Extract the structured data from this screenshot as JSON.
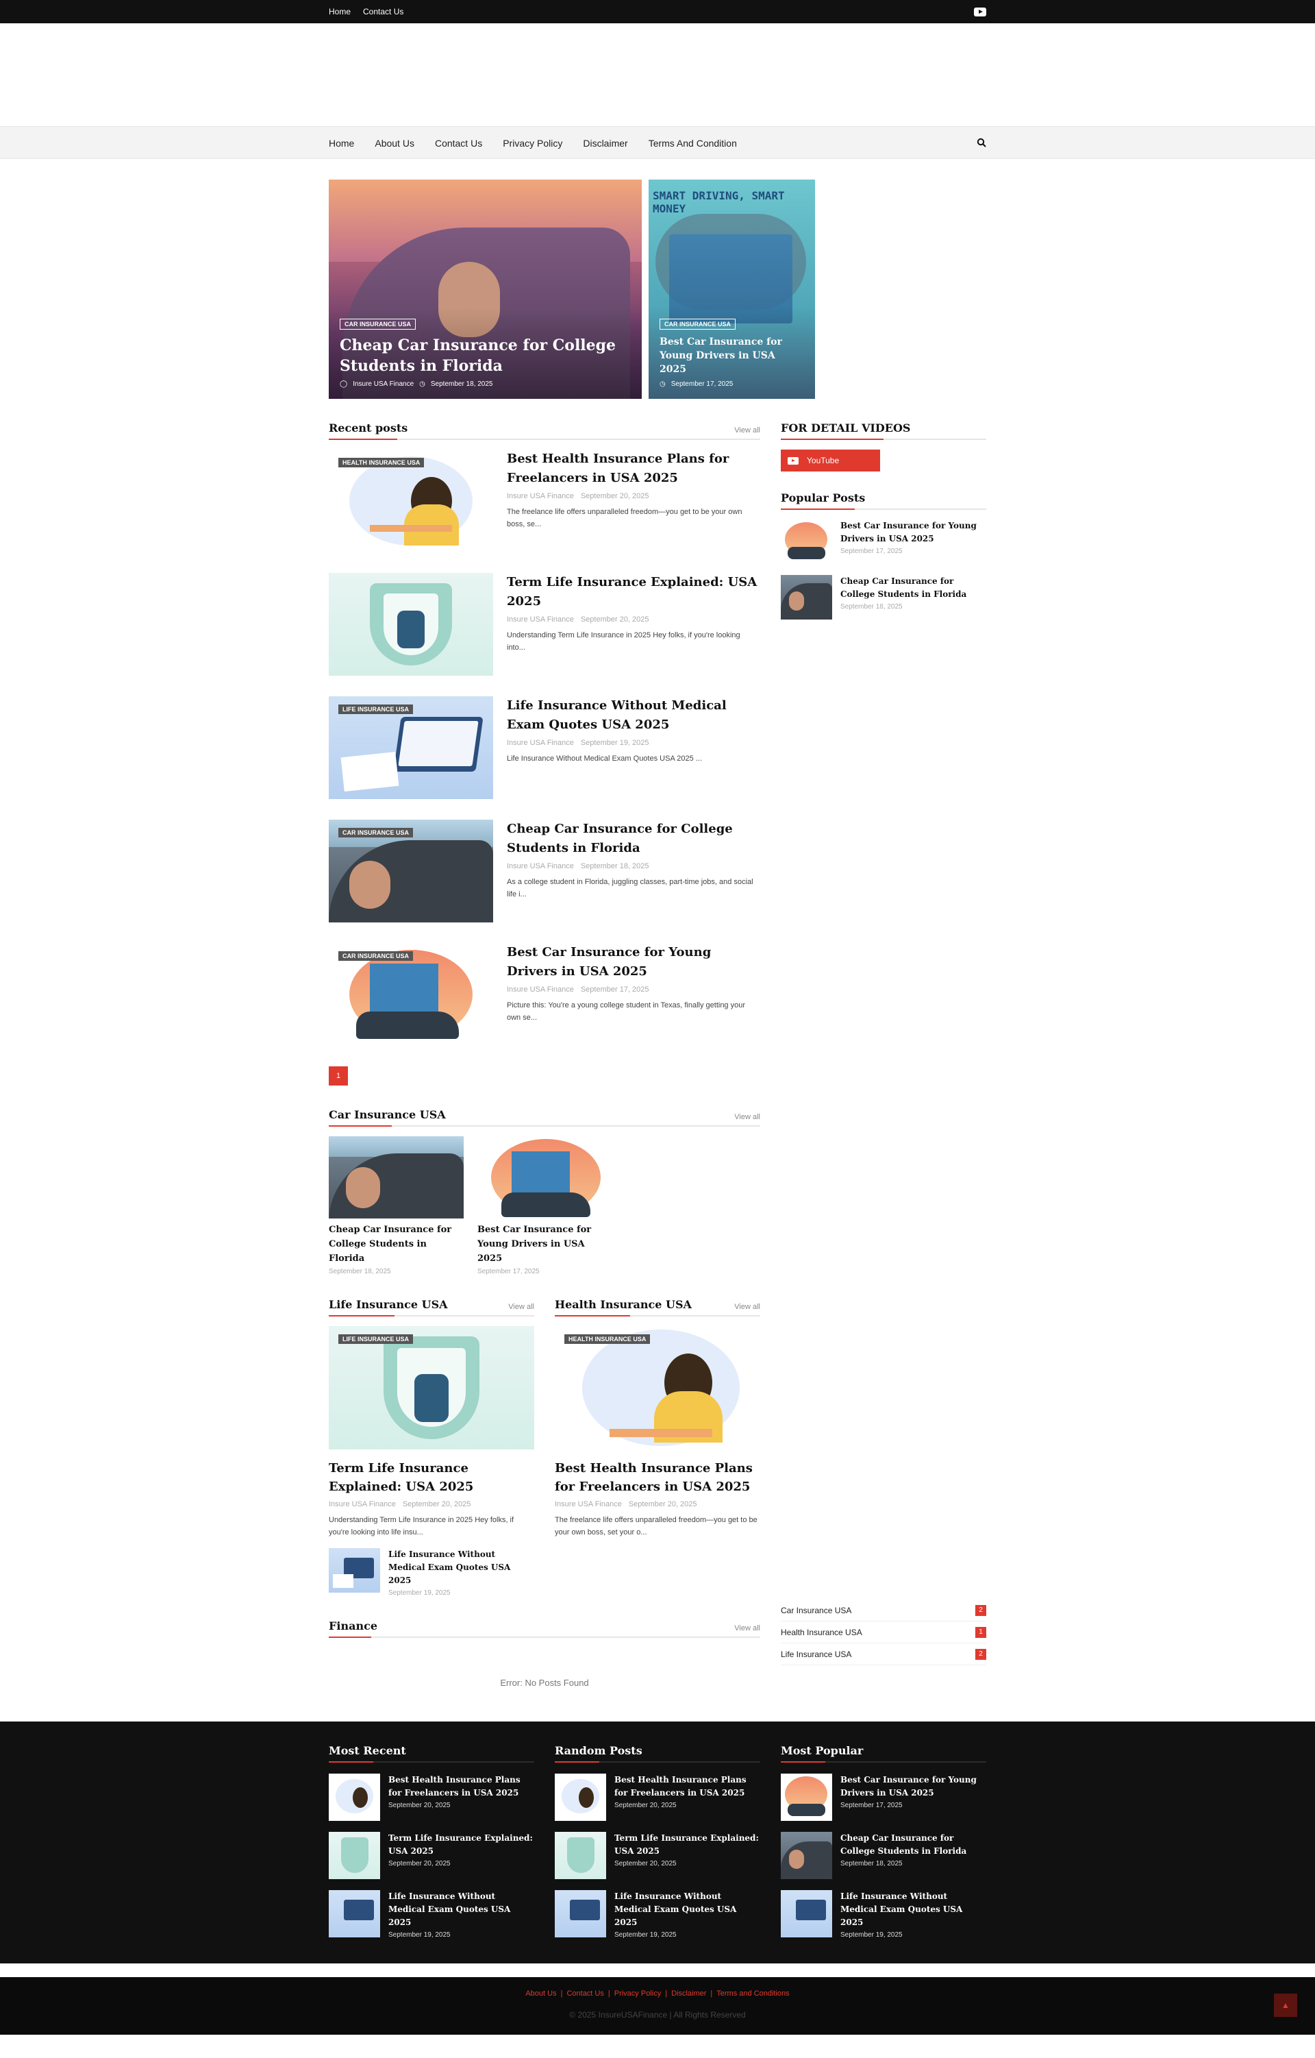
{
  "topbar": {
    "links": [
      "Home",
      "Contact Us"
    ]
  },
  "nav": {
    "items": [
      "Home",
      "About Us",
      "Contact Us",
      "Privacy Policy",
      "Disclaimer",
      "Terms And Condition"
    ]
  },
  "featured": {
    "big": {
      "badge": "CAR INSURANCE USA",
      "title": "Cheap Car Insurance for College Students in Florida",
      "author": "Insure USA Finance",
      "date": "September 18, 2025"
    },
    "small": {
      "banner": "SMART DRIVING, SMART MONEY",
      "badge": "CAR INSURANCE USA",
      "title": "Best Car Insurance for Young Drivers in USA 2025",
      "date": "September 17, 2025"
    }
  },
  "recent": {
    "heading": "Recent posts",
    "view_all": "View all",
    "posts": [
      {
        "label": "HEALTH INSURANCE USA",
        "title": "Best Health Insurance Plans for Freelancers in USA 2025",
        "author": "Insure USA Finance",
        "date": "September 20, 2025",
        "excerpt": "The freelance life offers unparalleled freedom—you get to be your own boss, se..."
      },
      {
        "label": "",
        "title": "Term Life Insurance Explained: USA 2025",
        "author": "Insure USA Finance",
        "date": "September 20, 2025",
        "excerpt": "Understanding Term Life Insurance in 2025 Hey folks, if you're looking into..."
      },
      {
        "label": "LIFE INSURANCE USA",
        "title": "Life Insurance Without Medical Exam Quotes USA 2025",
        "author": "Insure USA Finance",
        "date": "September 19, 2025",
        "excerpt": "Life Insurance Without Medical Exam Quotes USA 2025 ..."
      },
      {
        "label": "CAR INSURANCE USA",
        "title": "Cheap Car Insurance for College Students in Florida",
        "author": "Insure USA Finance",
        "date": "September 18, 2025",
        "excerpt": "As a college student in Florida, juggling classes, part-time jobs, and social life i..."
      },
      {
        "label": "CAR INSURANCE USA",
        "title": "Best Car Insurance for Young Drivers in USA 2025",
        "author": "Insure USA Finance",
        "date": "September 17, 2025",
        "excerpt": "Picture this: You're a young college student in Texas, finally getting your own se..."
      }
    ],
    "page": "1"
  },
  "car_section": {
    "heading": "Car Insurance USA",
    "view_all": "View all",
    "cards": [
      {
        "title": "Cheap Car Insurance for College Students in Florida",
        "date": "September 18, 2025"
      },
      {
        "title": "Best Car Insurance for Young Drivers in USA 2025",
        "date": "September 17, 2025"
      }
    ]
  },
  "life_section": {
    "heading": "Life Insurance USA",
    "view_all": "View all",
    "label": "LIFE INSURANCE USA",
    "title": "Term Life Insurance Explained: USA 2025",
    "author": "Insure USA Finance",
    "date": "September 20, 2025",
    "excerpt": "Understanding Term Life Insurance in 2025 Hey folks, if you're looking into life insu...",
    "small": {
      "title": "Life Insurance Without Medical Exam Quotes USA 2025",
      "date": "September 19, 2025"
    }
  },
  "health_section": {
    "heading": "Health Insurance USA",
    "view_all": "View all",
    "label": "HEALTH INSURANCE USA",
    "title": "Best Health Insurance Plans for Freelancers in USA 2025",
    "author": "Insure USA Finance",
    "date": "September 20, 2025",
    "excerpt": "The freelance life offers unparalleled freedom—you get to be your own boss, set your o..."
  },
  "finance_section": {
    "heading": "Finance",
    "view_all": "View all",
    "error": "Error: No Posts Found"
  },
  "sidebar": {
    "videos_heading": "FOR DETAIL VIDEOS",
    "youtube_label": "YouTube",
    "popular_heading": "Popular Posts",
    "popular": [
      {
        "title": "Best Car Insurance for Young Drivers in USA 2025",
        "date": "September 17, 2025"
      },
      {
        "title": "Cheap Car Insurance for College Students in Florida",
        "date": "September 18, 2025"
      }
    ],
    "labels": [
      {
        "name": "Car Insurance USA",
        "count": "2"
      },
      {
        "name": "Health Insurance USA",
        "count": "1"
      },
      {
        "name": "Life Insurance USA",
        "count": "2"
      }
    ]
  },
  "footer": {
    "most_recent": {
      "heading": "Most Recent",
      "items": [
        {
          "title": "Best Health Insurance Plans for Freelancers in USA 2025",
          "date": "September 20, 2025"
        },
        {
          "title": "Term Life Insurance Explained: USA 2025",
          "date": "September 20, 2025"
        },
        {
          "title": "Life Insurance Without Medical Exam Quotes USA 2025",
          "date": "September 19, 2025"
        }
      ]
    },
    "random": {
      "heading": "Random Posts",
      "items": [
        {
          "title": "Best Health Insurance Plans for Freelancers in USA 2025",
          "date": "September 20, 2025"
        },
        {
          "title": "Term Life Insurance Explained: USA 2025",
          "date": "September 20, 2025"
        },
        {
          "title": "Life Insurance Without Medical Exam Quotes USA 2025",
          "date": "September 19, 2025"
        }
      ]
    },
    "popular": {
      "heading": "Most Popular",
      "items": [
        {
          "title": "Best Car Insurance for Young Drivers in USA 2025",
          "date": "September 17, 2025"
        },
        {
          "title": "Cheap Car Insurance for College Students in Florida",
          "date": "September 18, 2025"
        },
        {
          "title": "Life Insurance Without Medical Exam Quotes USA 2025",
          "date": "September 19, 2025"
        }
      ]
    },
    "links": [
      "About Us",
      "Contact Us",
      "Privacy Policy",
      "Disclaimer",
      "Terms and Conditions"
    ],
    "copyright": "© 2025 InsureUSAFinance | All Rights Reserved"
  },
  "colors": {
    "accent": "#e03a2f",
    "dark": "#111111",
    "nav_bg": "#f3f3f3"
  }
}
